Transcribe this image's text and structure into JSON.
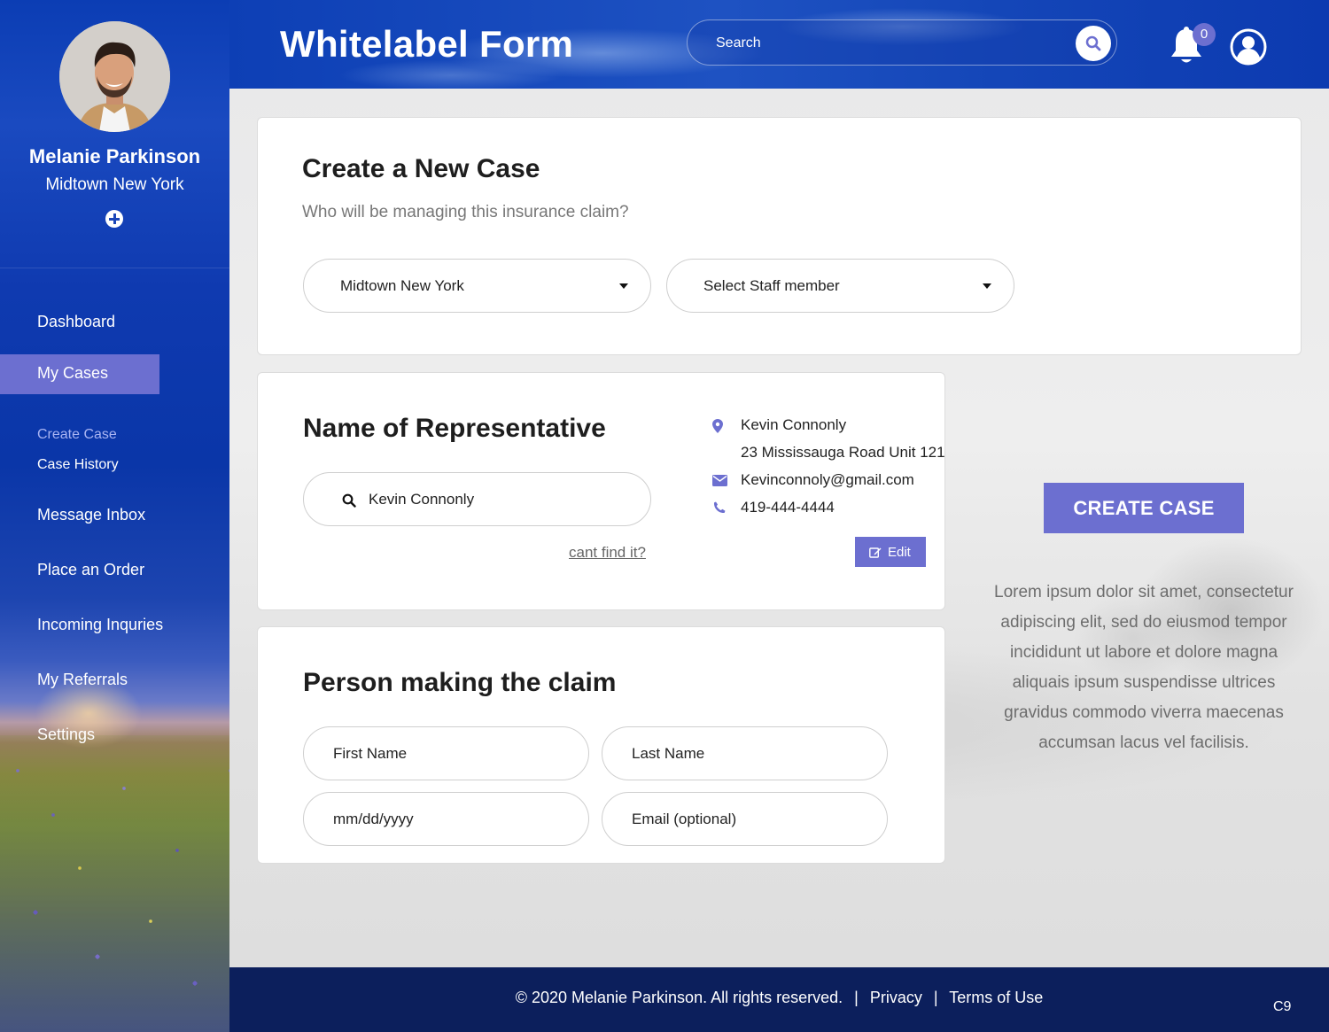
{
  "app": {
    "title": "Whitelabel Form"
  },
  "header": {
    "search_placeholder": "Search",
    "notification_count": "0"
  },
  "sidebar": {
    "user_name": "Melanie Parkinson",
    "user_location": "Midtown New York",
    "nav": {
      "dashboard": "Dashboard",
      "my_cases": "My Cases",
      "create_case": "Create Case",
      "case_history": "Case History",
      "message_inbox": "Message Inbox",
      "place_order": "Place an Order",
      "incoming_inquries": "Incoming Inquries",
      "my_referrals": "My Referrals",
      "settings": "Settings"
    }
  },
  "new_case": {
    "title": "Create a New Case",
    "subtitle": "Who will be managing this insurance claim?",
    "location_select": "Midtown New York",
    "staff_select": "Select Staff member"
  },
  "representative": {
    "title": "Name of Representative",
    "search_value": "Kevin Connonly",
    "cant_find": "cant find it?",
    "contact": {
      "name": "Kevin Connonly",
      "address": "23 Mississauga Road Unit 121",
      "email": "Kevinconnoly@gmail.com",
      "phone": "419-444-4444"
    },
    "edit_label": "Edit"
  },
  "claimant": {
    "title": "Person making the claim",
    "first_name_placeholder": "First Name",
    "last_name_placeholder": "Last Name",
    "dob_placeholder": "mm/dd/yyyy",
    "email_placeholder": "Email (optional)"
  },
  "aside": {
    "create_button": "CREATE CASE",
    "description": "Lorem ipsum dolor sit amet, consectetur adipiscing elit, sed do eiusmod tempor incididunt ut labore et dolore magna aliquais ipsum suspendisse ultrices gravidus commodo viverra maecenas accumsan lacus vel facilisis."
  },
  "footer": {
    "copyright": "© 2020 Melanie Parkinson. All rights reserved.",
    "privacy": "Privacy",
    "terms": "Terms of Use",
    "separator": "|",
    "code": "C9"
  },
  "colors": {
    "accent": "#6c6fd0",
    "header_blue": "#1446b8",
    "footer_navy": "#0c1f5c"
  }
}
